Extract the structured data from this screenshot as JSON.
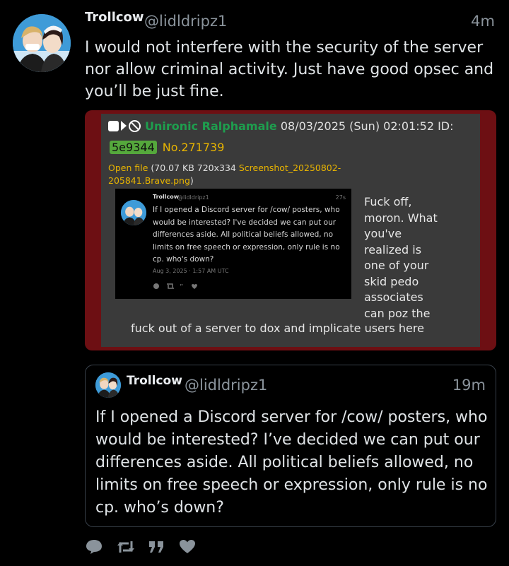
{
  "post": {
    "author_name": "Trollcow",
    "handle": "@lidldripz1",
    "time": "4m",
    "text": "I would not interfere with the security of the server nor allow criminal activity. Just have good opsec and you’ll be just fine."
  },
  "screenshot": {
    "poster_name": "Unironic Ralphamale",
    "date": "08/03/2025 (Sun) 02:01:52 ID:",
    "id_badge": "5e9344",
    "post_no": "No.271739",
    "file_prefix": "Open file",
    "file_info": "(70.07 KB 720x334",
    "file_name": "Screenshot_20250802-205841.Brave.png",
    "file_close": ")",
    "embedded": {
      "name": "Trollcow",
      "handle": "@lidldripz1",
      "time": "27s",
      "text": "If I opened a Discord server for /cow/ posters, who would be interested? I've decided we can put our differences aside. All political beliefs allowed, no limits on free speech or expression, only rule is no cp. who's down?",
      "date": "Aug 3, 2025 · 1:57 AM UTC"
    },
    "reply_wrapped": "Fuck off, moron. What you've realized is one of your skid pedo associates can poz the",
    "reply_tail": "fuck out of a server to dox and implicate users here"
  },
  "quote": {
    "author_name": "Trollcow",
    "handle": "@lidldripz1",
    "time": "19m",
    "text": "If I opened a Discord server for /cow/ posters, who would be interested? I’ve decided we can put our differences aside. All political beliefs allowed, no limits on free speech or expression, only rule is no cp. who’s down?"
  },
  "actions": [
    "reply-icon",
    "retweet-icon",
    "quote-icon",
    "like-icon"
  ],
  "colors": {
    "background": "#000000",
    "muted": "#8a939b",
    "screenshot_border": "#6d0f13",
    "poster_green": "#1e9e4e",
    "link_yellow": "#e8b400"
  }
}
